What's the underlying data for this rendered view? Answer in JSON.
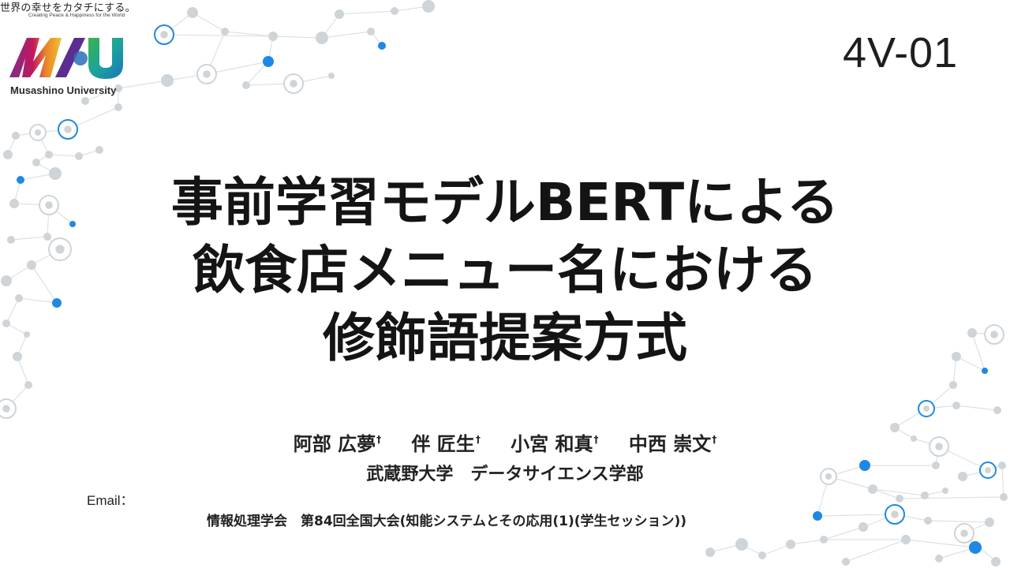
{
  "header": {
    "tagline_jp": "世界の幸せをカタチにする。",
    "tagline_en": "Creating Peace & Happiness for the World",
    "university_name": "Musashino University",
    "session_code": "4V-01"
  },
  "title_lines": [
    "事前学習モデルBERTによる",
    "飲食店メニュー名における",
    "修飾語提案方式"
  ],
  "authors": [
    {
      "name": "阿部 広夢",
      "mark": "†"
    },
    {
      "name": "伴 匠生",
      "mark": "†"
    },
    {
      "name": "小宮 和真",
      "mark": "†"
    },
    {
      "name": "中西 崇文",
      "mark": "†"
    }
  ],
  "affiliation": "武蔵野大学　データサイエンス学部",
  "email": {
    "label": "Email：",
    "value": ""
  },
  "conference": "情報処理学会　第84回全国大会(知能システムとその応用(1)(学生セッション))",
  "colors": {
    "network_node": "#cfd4d8",
    "network_line": "#dde1e4",
    "accent_blue": "#1e88e5",
    "logo_purple": "#8e2a8f",
    "logo_green": "#39b54a",
    "logo_blue": "#1b75bb"
  }
}
